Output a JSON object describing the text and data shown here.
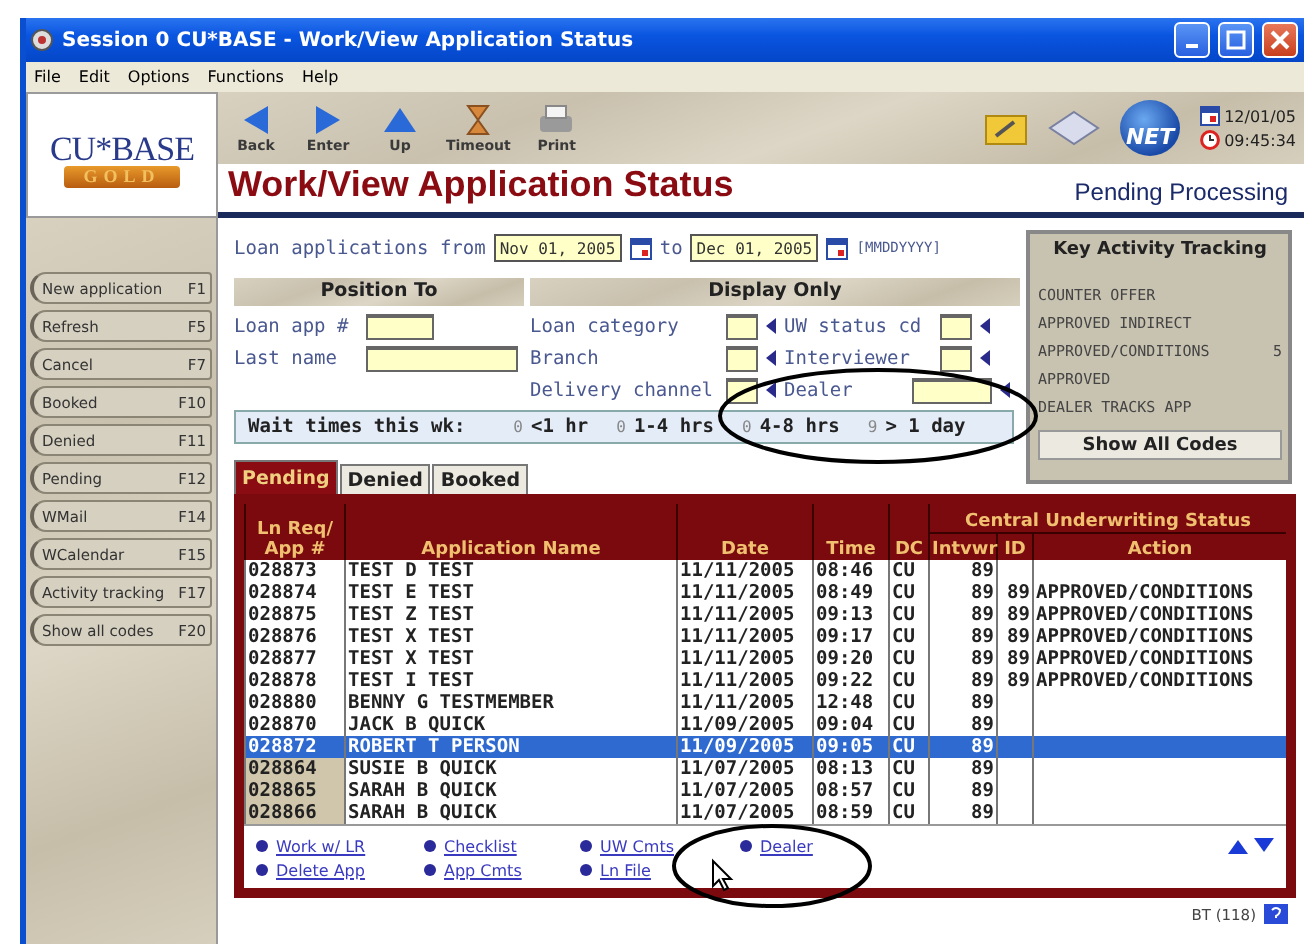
{
  "window": {
    "title": "Session 0 CU*BASE - Work/View Application Status"
  },
  "menu": [
    "File",
    "Edit",
    "Options",
    "Functions",
    "Help"
  ],
  "logo": {
    "name": "CU*BASE",
    "badge": "GOLD"
  },
  "toolbar": [
    {
      "label": "Back",
      "kind": "back"
    },
    {
      "label": "Enter",
      "kind": "enter"
    },
    {
      "label": "Up",
      "kind": "up"
    },
    {
      "label": "Timeout",
      "kind": "timeout"
    },
    {
      "label": "Print",
      "kind": "print"
    }
  ],
  "net_logo": "NET",
  "date": "12/01/05",
  "time": "09:45:34",
  "heading": {
    "title": "Work/View Application Status",
    "subtitle": "Pending Processing"
  },
  "sidebar": [
    {
      "label": "New application",
      "key": "F1"
    },
    {
      "label": "Refresh",
      "key": "F5"
    },
    {
      "label": "Cancel",
      "key": "F7"
    },
    {
      "label": "Booked",
      "key": "F10"
    },
    {
      "label": "Denied",
      "key": "F11"
    },
    {
      "label": "Pending",
      "key": "F12"
    },
    {
      "label": "WMail",
      "key": "F14"
    },
    {
      "label": "WCalendar",
      "key": "F15"
    },
    {
      "label": "Activity tracking",
      "key": "F17"
    },
    {
      "label": "Show all codes",
      "key": "F20"
    }
  ],
  "date_range": {
    "label_from": "Loan applications from",
    "from": "Nov 01, 2005",
    "label_to": "to",
    "to": "Dec 01, 2005",
    "format": "[MMDDYYYY]"
  },
  "position_to": {
    "title": "Position To",
    "fields": [
      {
        "label": "Loan app #",
        "kind": "short"
      },
      {
        "label": "Last name",
        "kind": "long"
      }
    ]
  },
  "display_only": {
    "title": "Display Only",
    "fields": [
      {
        "label": "Loan category",
        "kind": "short"
      },
      {
        "label": "Branch",
        "kind": "short"
      },
      {
        "label": "Delivery channel",
        "kind": "short"
      },
      {
        "label": "UW status cd",
        "kind": "short"
      },
      {
        "label": "Interviewer",
        "kind": "short"
      },
      {
        "label": "Dealer",
        "kind": "long"
      }
    ]
  },
  "wait_times": {
    "label": "Wait times this wk:",
    "items": [
      {
        "count": "0",
        "label": "<1 hr"
      },
      {
        "count": "0",
        "label": "1-4 hrs"
      },
      {
        "count": "0",
        "label": "4-8 hrs"
      },
      {
        "count": "9",
        "label": "> 1 day"
      }
    ]
  },
  "key_activity": {
    "title": "Key Activity Tracking",
    "items": [
      {
        "label": "COUNTER OFFER"
      },
      {
        "label": "APPROVED INDIRECT"
      },
      {
        "label": "APPROVED/CONDITIONS",
        "count": "5"
      },
      {
        "label": "APPROVED"
      },
      {
        "label": "DEALER TRACKS APP"
      }
    ],
    "button": "Show All Codes"
  },
  "tabs": [
    {
      "label": "Pending",
      "selected": true
    },
    {
      "label": "Denied",
      "selected": false
    },
    {
      "label": "Booked",
      "selected": false
    }
  ],
  "table": {
    "group_header": "Central Underwriting Status",
    "columns": [
      "Ln Req/ App #",
      "Application Name",
      "Date",
      "Time",
      "DC",
      "Intvwr",
      "ID",
      "Action"
    ],
    "rows": [
      {
        "app": "028873",
        "name": "TEST D TEST",
        "date": "11/11/2005",
        "time": "08:46",
        "dc": "CU",
        "intvwr": "89",
        "selected": false,
        "shaded": false
      },
      {
        "app": "028874",
        "name": "TEST E TEST",
        "date": "11/11/2005",
        "time": "08:49",
        "dc": "CU",
        "intvwr": "89",
        "id": "89",
        "action": "APPROVED/CONDITIONS",
        "selected": false,
        "shaded": false
      },
      {
        "app": "028875",
        "name": "TEST Z TEST",
        "date": "11/11/2005",
        "time": "09:13",
        "dc": "CU",
        "intvwr": "89",
        "id": "89",
        "action": "APPROVED/CONDITIONS",
        "selected": false,
        "shaded": false
      },
      {
        "app": "028876",
        "name": "TEST X TEST",
        "date": "11/11/2005",
        "time": "09:17",
        "dc": "CU",
        "intvwr": "89",
        "id": "89",
        "action": "APPROVED/CONDITIONS",
        "selected": false,
        "shaded": false
      },
      {
        "app": "028877",
        "name": "TEST X TEST",
        "date": "11/11/2005",
        "time": "09:20",
        "dc": "CU",
        "intvwr": "89",
        "id": "89",
        "action": "APPROVED/CONDITIONS",
        "selected": false,
        "shaded": false
      },
      {
        "app": "028878",
        "name": "TEST I TEST",
        "date": "11/11/2005",
        "time": "09:22",
        "dc": "CU",
        "intvwr": "89",
        "id": "89",
        "action": "APPROVED/CONDITIONS",
        "selected": false,
        "shaded": false
      },
      {
        "app": "028880",
        "name": "BENNY G TESTMEMBER",
        "date": "11/11/2005",
        "time": "12:48",
        "dc": "CU",
        "intvwr": "89",
        "selected": false,
        "shaded": false
      },
      {
        "app": "028870",
        "name": "JACK B QUICK",
        "date": "11/09/2005",
        "time": "09:04",
        "dc": "CU",
        "intvwr": "89",
        "selected": false,
        "shaded": false
      },
      {
        "app": "028872",
        "name": "ROBERT T PERSON",
        "date": "11/09/2005",
        "time": "09:05",
        "dc": "CU",
        "intvwr": "89",
        "selected": true,
        "shaded": false
      },
      {
        "app": "028864",
        "name": "SUSIE B QUICK",
        "date": "11/07/2005",
        "time": "08:13",
        "dc": "CU",
        "intvwr": "89",
        "selected": false,
        "shaded": true
      },
      {
        "app": "028865",
        "name": "SARAH B QUICK",
        "date": "11/07/2005",
        "time": "08:57",
        "dc": "CU",
        "intvwr": "89",
        "selected": false,
        "shaded": true
      },
      {
        "app": "028866",
        "name": "SARAH B QUICK",
        "date": "11/07/2005",
        "time": "08:59",
        "dc": "CU",
        "intvwr": "89",
        "selected": false,
        "shaded": true
      }
    ]
  },
  "links": [
    "Work w/ LR",
    "Checklist",
    "UW Cmts",
    "Dealer",
    "Delete App",
    "App Cmts",
    "Ln File"
  ],
  "status": "BT (118)"
}
